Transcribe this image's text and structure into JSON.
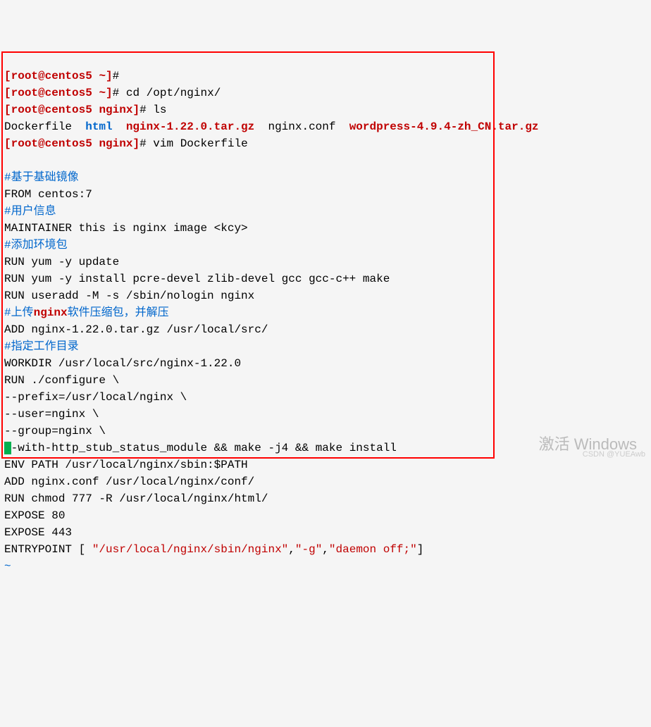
{
  "prompt": {
    "open": "[",
    "user_host": "root@centos5",
    "path_home": "~",
    "path_nginx": "nginx",
    "close": "]",
    "hash": "#"
  },
  "commands": {
    "cd": "cd /opt/nginx/",
    "ls": "ls",
    "vim": "vim Dockerfile"
  },
  "ls_output": {
    "dockerfile": "Dockerfile",
    "html": "html",
    "nginx_tar": "nginx-1.22.0.tar.gz",
    "nginx_conf": "nginx.conf",
    "wordpress_tar": "wordpress-4.9.4-zh_CN.tar.gz"
  },
  "dockerfile": {
    "c1": "#基于基础镜像",
    "from": "FROM centos:7",
    "c2": "#用户信息",
    "maintainer": "MAINTAINER this is nginx image <kcy>",
    "c3": "#添加环境包",
    "run_update": "RUN yum -y update",
    "run_install": "RUN yum -y install pcre-devel zlib-devel gcc gcc-c++ make",
    "run_useradd": "RUN useradd -M -s /sbin/nologin nginx",
    "c4_prefix": "#上传",
    "c4_bold": "nginx",
    "c4_suffix": "软件压缩包，并解压",
    "add_tar": "ADD nginx-1.22.0.tar.gz /usr/local/src/",
    "c5": "#指定工作目录",
    "workdir": "WORKDIR /usr/local/src/nginx-1.22.0",
    "run_configure": "RUN ./configure \\",
    "prefix": "--prefix=/usr/local/nginx \\",
    "user": "--user=nginx \\",
    "group": "--group=nginx \\",
    "with_cursor": "-",
    "with_rest": "-with-http_stub_status_module && make -j4 && make install",
    "env": "ENV PATH /usr/local/nginx/sbin:$PATH",
    "add_conf": "ADD nginx.conf /usr/local/nginx/conf/",
    "run_chmod": "RUN chmod 777 -R /usr/local/nginx/html/",
    "expose80": "EXPOSE 80",
    "expose443": "EXPOSE 443",
    "entrypoint_pre": "ENTRYPOINT [ ",
    "entrypoint_s1": "\"/usr/local/nginx/sbin/nginx\"",
    "entrypoint_c1": ",",
    "entrypoint_s2": "\"-g\"",
    "entrypoint_c2": ",",
    "entrypoint_s3": "\"daemon off;\"",
    "entrypoint_post": "]"
  },
  "tilde": "~",
  "watermark": "激活 Windows",
  "csdn": "CSDN @YUEAwb"
}
